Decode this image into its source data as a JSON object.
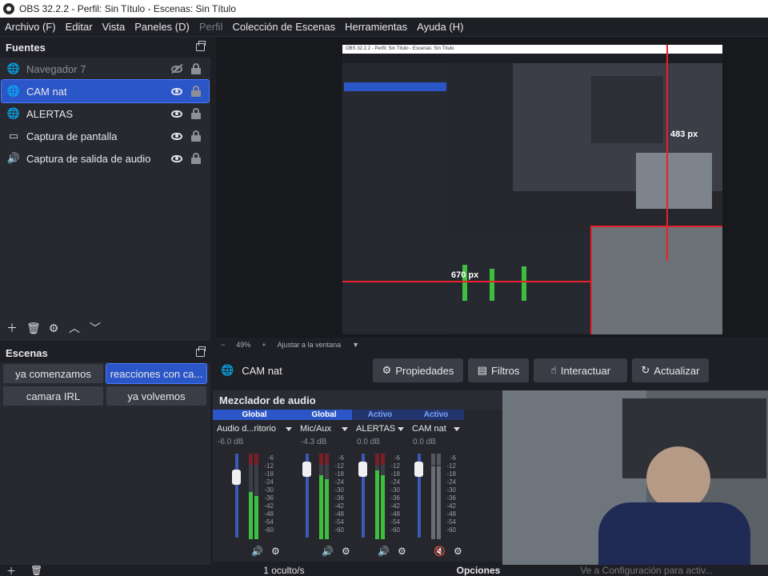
{
  "window": {
    "title": "OBS 32.2.2 - Perfil: Sin Título - Escenas: Sin Título"
  },
  "menu": [
    "Archivo (F)",
    "Editar",
    "Vista",
    "Paneles (D)",
    "Perfil",
    "Colección de Escenas",
    "Herramientas",
    "Ayuda (H)"
  ],
  "sources": {
    "title": "Fuentes",
    "items": [
      {
        "label": "Navegador 7",
        "icon": "globe-icon",
        "visible": false,
        "selected": false
      },
      {
        "label": "CAM nat",
        "icon": "globe-icon",
        "visible": true,
        "selected": true
      },
      {
        "label": "ALERTAS",
        "icon": "globe-icon",
        "visible": true,
        "selected": false
      },
      {
        "label": "Captura de pantalla",
        "icon": "monitor-icon",
        "visible": true,
        "selected": false
      },
      {
        "label": "Captura de salida de audio",
        "icon": "speaker-icon",
        "visible": true,
        "selected": false
      }
    ]
  },
  "scenes": {
    "title": "Escenas",
    "items": [
      "ya comenzamos",
      "reacciones con ca...",
      "camara IRL",
      "ya volvemos"
    ],
    "active_index": 1
  },
  "preview": {
    "nested_title": "OBS 32.2.2 - Perfil: Sin Título - Escenas: Sin Título",
    "size_label_1": "483 px",
    "size_label_2": "670 px"
  },
  "zoom": {
    "minus": "−",
    "value": "49%",
    "plus": "+",
    "fit": "Ajustar a la ventana"
  },
  "context": {
    "source": "CAM nat",
    "buttons": [
      "Propiedades",
      "Filtros",
      "Interactuar",
      "Actualizar"
    ]
  },
  "mixer": {
    "title": "Mezclador de audio",
    "channels": [
      {
        "tag": "Global",
        "name": "Audio d...ritorio",
        "db": "-6.0 dB",
        "level": 0.55,
        "muted": false
      },
      {
        "tag": "Global",
        "name": "Mic/Aux",
        "db": "-4.3 dB",
        "level": 0.75,
        "muted": false
      },
      {
        "tag": "Activo",
        "name": "ALERTAS",
        "db": "0.0 dB",
        "level": 0.8,
        "muted": false
      },
      {
        "tag": "Activo",
        "name": "CAM nat",
        "db": "0.0 dB",
        "level": 0.85,
        "muted": true
      }
    ],
    "scale": [
      "-6",
      "-12",
      "-18",
      "-24",
      "-30",
      "-36",
      "-42",
      "-48",
      "-54",
      "-60"
    ]
  },
  "status": {
    "hidden": "1 oculto/s",
    "options": "Opciones",
    "activation": "Ve a Configuración para activ..."
  },
  "colors": {
    "accent": "#2b56c7",
    "selection_outline": "#4a7bff",
    "meter_green": "#3fbf3f",
    "meter_red": "#7a1f28",
    "guide_red": "#e8202a"
  }
}
